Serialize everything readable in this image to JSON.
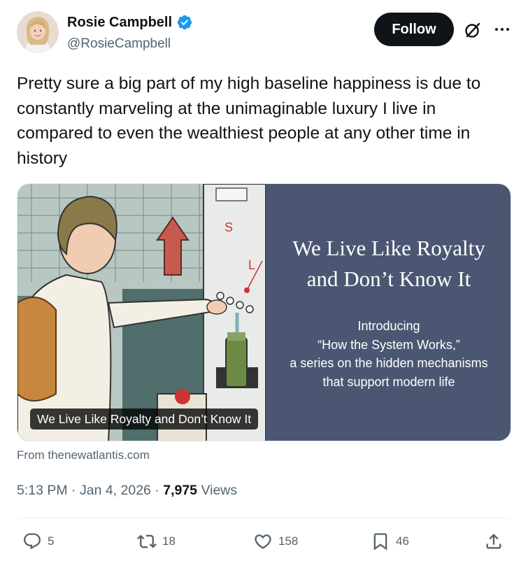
{
  "author": {
    "name": "Rosie Campbell",
    "handle": "@RosieCampbell",
    "verified_color": "#1d9bf0"
  },
  "header": {
    "follow_label": "Follow",
    "grok_icon": "grok-icon",
    "more_icon": "more-icon"
  },
  "tweet": {
    "text": "Pretty sure a big part of my high baseline happiness is due to constantly marveling at the unimaginable luxury I live in compared to even the wealthiest people at any other time in history"
  },
  "card": {
    "title_line1": "We Live Like Royalty",
    "title_line2": "and Don’t Know It",
    "intro_line1": "Introducing",
    "intro_line2": "“How the System Works,”",
    "intro_line3": "a series on the hidden mechanisms",
    "intro_line4": "that support modern life",
    "caption": "We Live Like Royalty and Don’t Know It",
    "panel_color": "#4b5772",
    "source": "From thenewatlantis.com"
  },
  "meta": {
    "time": "5:13 PM",
    "separator": "·",
    "date": "Jan 4, 2026",
    "views_count": "7,975",
    "views_label": "Views"
  },
  "actions": {
    "replies": "5",
    "reposts": "18",
    "likes": "158",
    "bookmarks": "46"
  }
}
